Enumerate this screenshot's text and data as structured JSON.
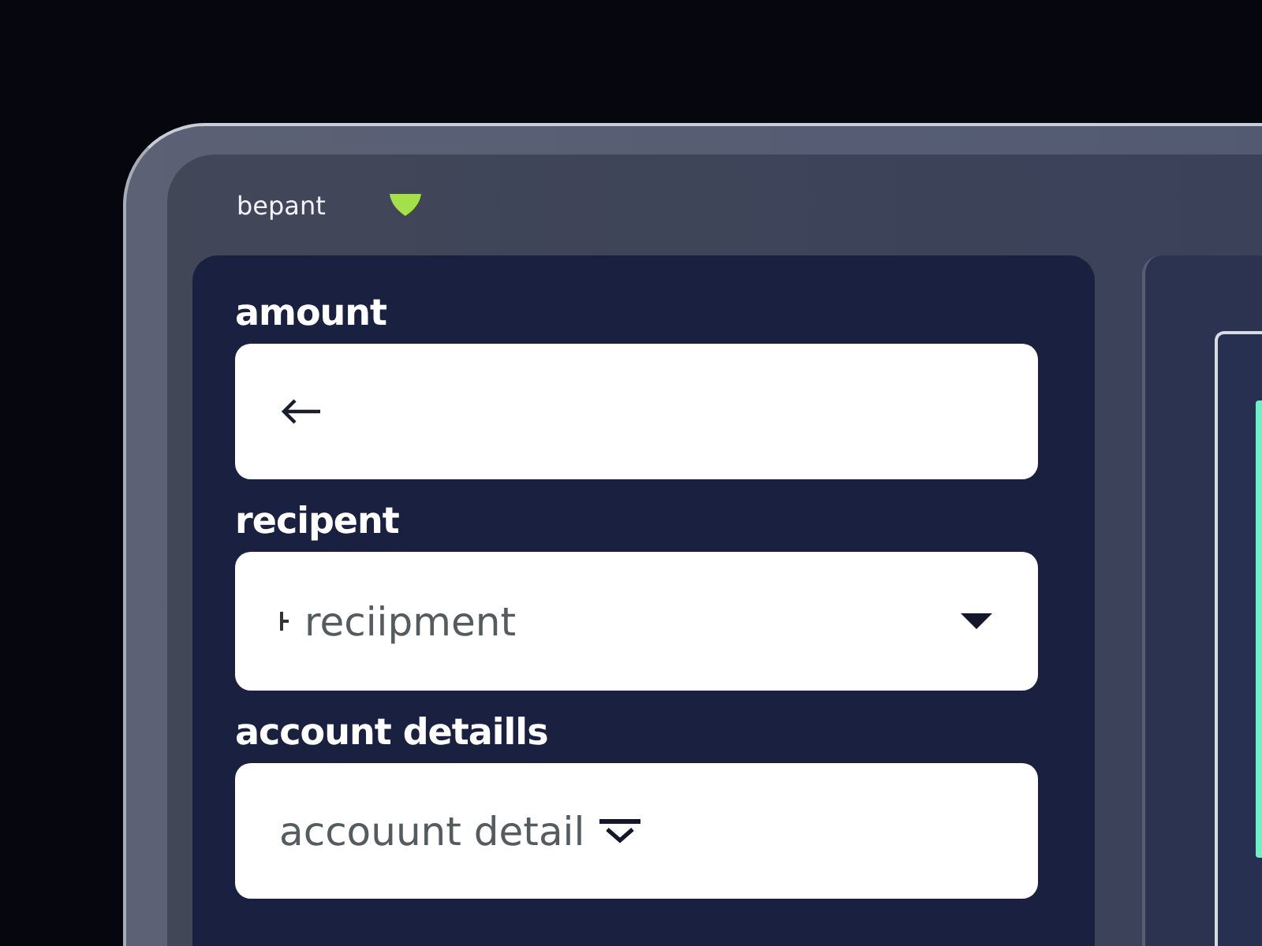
{
  "header": {
    "brand": "bepant"
  },
  "form": {
    "fields": [
      {
        "label": "amount",
        "kind": "back-arrow"
      },
      {
        "label": "recipent",
        "kind": "select",
        "value": "reciipment"
      },
      {
        "label": "account detaills",
        "kind": "inline-icon",
        "value": "accouunt detail"
      }
    ]
  }
}
